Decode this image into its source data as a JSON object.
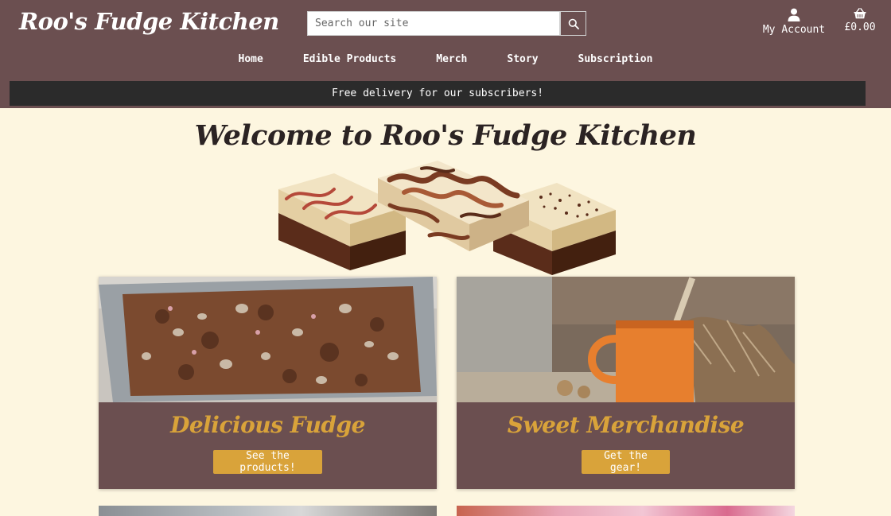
{
  "header": {
    "logo": "Roo's Fudge Kitchen",
    "search_placeholder": "Search our site",
    "account_label": "My Account",
    "cart_total": "£0.00"
  },
  "nav": {
    "items": [
      "Home",
      "Edible Products",
      "Merch",
      "Story",
      "Subscription"
    ]
  },
  "banner": {
    "text": "Free delivery for our subscribers!"
  },
  "main": {
    "welcome_title": "Welcome to Roo's Fudge Kitchen",
    "cards": [
      {
        "title": "Delicious Fudge",
        "button": "See the products!"
      },
      {
        "title": "Sweet Merchandise",
        "button": "Get the gear!"
      }
    ]
  },
  "colors": {
    "header_bg": "#6b4f50",
    "page_bg": "#fdf6e0",
    "accent": "#d9a33a",
    "banner_bg": "#2b2b2b"
  },
  "icons": {
    "search": "search-icon",
    "account": "user-icon",
    "cart": "basket-icon"
  }
}
